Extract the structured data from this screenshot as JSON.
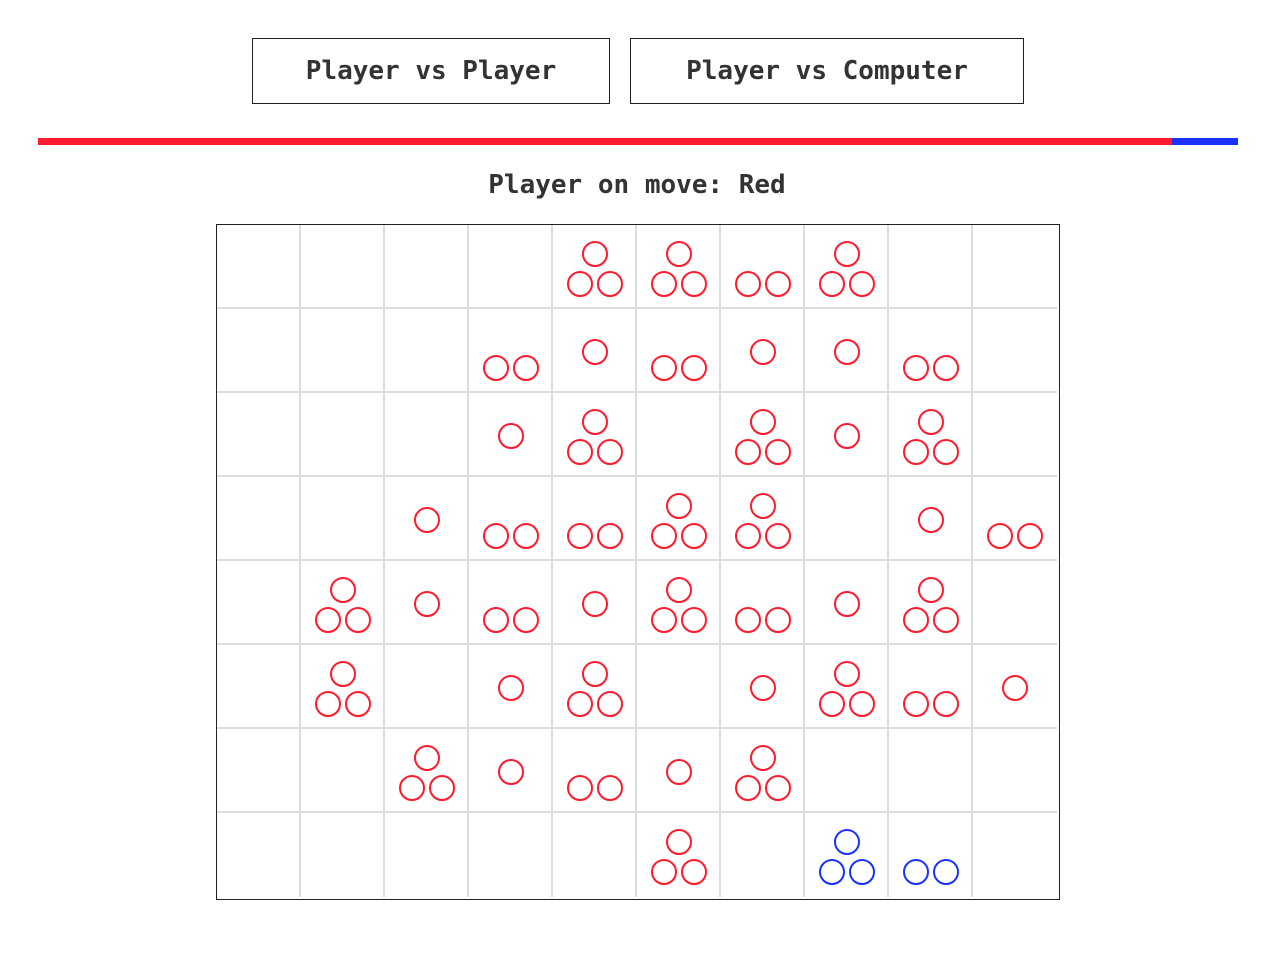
{
  "mode_buttons": {
    "pvp_label": "Player vs Player",
    "pvc_label": "Player vs Computer"
  },
  "score_bar": {
    "red_fraction": 0.945,
    "blue_fraction": 0.055,
    "red_color": "#ff1a2e",
    "blue_color": "#1a32ff"
  },
  "status": {
    "turn_text": "Player on move: Red"
  },
  "colors": {
    "red": "#ff1a2e",
    "blue": "#1a32ff"
  },
  "board": {
    "rows": 8,
    "cols": 10,
    "cells": [
      [
        [
          0,
          null
        ],
        [
          0,
          null
        ],
        [
          0,
          null
        ],
        [
          0,
          null
        ],
        [
          3,
          "red"
        ],
        [
          3,
          "red"
        ],
        [
          2,
          "red"
        ],
        [
          3,
          "red"
        ],
        [
          0,
          null
        ],
        [
          0,
          null
        ]
      ],
      [
        [
          0,
          null
        ],
        [
          0,
          null
        ],
        [
          0,
          null
        ],
        [
          2,
          "red"
        ],
        [
          1,
          "red"
        ],
        [
          2,
          "red"
        ],
        [
          1,
          "red"
        ],
        [
          1,
          "red"
        ],
        [
          2,
          "red"
        ],
        [
          0,
          null
        ]
      ],
      [
        [
          0,
          null
        ],
        [
          0,
          null
        ],
        [
          0,
          null
        ],
        [
          1,
          "red"
        ],
        [
          3,
          "red"
        ],
        [
          0,
          null
        ],
        [
          3,
          "red"
        ],
        [
          1,
          "red"
        ],
        [
          3,
          "red"
        ],
        [
          0,
          null
        ]
      ],
      [
        [
          0,
          null
        ],
        [
          0,
          null
        ],
        [
          1,
          "red"
        ],
        [
          2,
          "red"
        ],
        [
          2,
          "red"
        ],
        [
          3,
          "red"
        ],
        [
          3,
          "red"
        ],
        [
          0,
          null
        ],
        [
          1,
          "red"
        ],
        [
          2,
          "red"
        ]
      ],
      [
        [
          0,
          null
        ],
        [
          3,
          "red"
        ],
        [
          1,
          "red"
        ],
        [
          2,
          "red"
        ],
        [
          1,
          "red"
        ],
        [
          3,
          "red"
        ],
        [
          2,
          "red"
        ],
        [
          1,
          "red"
        ],
        [
          3,
          "red"
        ],
        [
          0,
          null
        ]
      ],
      [
        [
          0,
          null
        ],
        [
          3,
          "red"
        ],
        [
          0,
          null
        ],
        [
          1,
          "red"
        ],
        [
          3,
          "red"
        ],
        [
          0,
          null
        ],
        [
          1,
          "red"
        ],
        [
          3,
          "red"
        ],
        [
          2,
          "red"
        ],
        [
          1,
          "red"
        ]
      ],
      [
        [
          0,
          null
        ],
        [
          0,
          null
        ],
        [
          3,
          "red"
        ],
        [
          1,
          "red"
        ],
        [
          2,
          "red"
        ],
        [
          1,
          "red"
        ],
        [
          3,
          "red"
        ],
        [
          0,
          null
        ],
        [
          0,
          null
        ],
        [
          0,
          null
        ]
      ],
      [
        [
          0,
          null
        ],
        [
          0,
          null
        ],
        [
          0,
          null
        ],
        [
          0,
          null
        ],
        [
          0,
          null
        ],
        [
          3,
          "red"
        ],
        [
          0,
          null
        ],
        [
          3,
          "blue"
        ],
        [
          2,
          "blue"
        ],
        [
          0,
          null
        ]
      ]
    ]
  }
}
